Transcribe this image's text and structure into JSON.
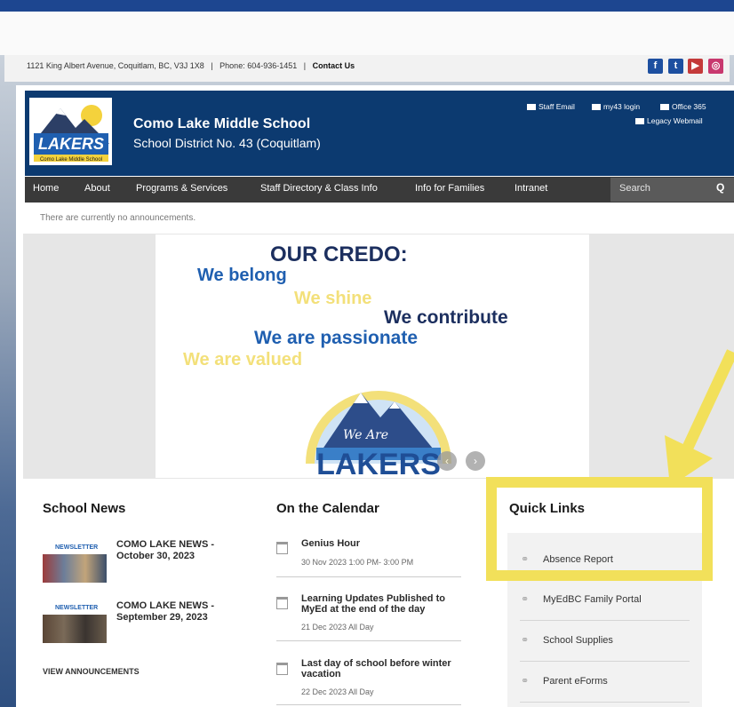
{
  "colors": {
    "header_bg": "#0c3a70",
    "nav_bg": "#3a3a3a",
    "highlight": "#f2e05a",
    "credo_blue": "#1f5fb0",
    "credo_yellow": "#f3e07a"
  },
  "address_bar": {
    "address": "1121 King Albert Avenue, Coquitlam, BC, V3J 1X8",
    "sep1": "|",
    "phone": "Phone: 604-936-1451",
    "sep2": "|",
    "contact": "Contact Us",
    "social": [
      "facebook-icon",
      "twitter-icon",
      "youtube-icon",
      "instagram-icon"
    ]
  },
  "header": {
    "logo_text": "LAKERS",
    "logo_caption": "Como Lake Middle School",
    "school_name": "Como Lake Middle School",
    "district": "School District No. 43 (Coquitlam)",
    "links": {
      "staff_email": "Staff Email",
      "my43": "my43 login",
      "office365": "Office 365",
      "legacy": "Legacy Webmail"
    }
  },
  "nav": {
    "items": [
      "Home",
      "About",
      "Programs & Services",
      "Staff Directory & Class Info",
      "Info for Families",
      "Intranet"
    ],
    "search_placeholder": "Search"
  },
  "announcement": "There are currently no announcements.",
  "slider": {
    "heading": "OUR CREDO:",
    "lines": [
      "We belong",
      "We shine",
      "We contribute",
      "We are passionate",
      "We are valued"
    ],
    "badge_top": "We Are",
    "badge_bottom": "LAKERS"
  },
  "news": {
    "title": "School News",
    "thumb_label": "NEWSLETTER",
    "items": [
      {
        "title": "COMO LAKE NEWS - October 30, 2023"
      },
      {
        "title": "COMO LAKE NEWS - September 29, 2023"
      }
    ],
    "view_all": "VIEW ANNOUNCEMENTS"
  },
  "calendar": {
    "title": "On the Calendar",
    "events": [
      {
        "title": "Genius Hour",
        "date": "30 Nov 2023 1:00 PM- 3:00 PM"
      },
      {
        "title": "Learning Updates Published to MyEd at the end of the day",
        "date": "21 Dec 2023 All Day"
      },
      {
        "title": "Last day of school before winter vacation",
        "date": "22 Dec 2023 All Day"
      }
    ]
  },
  "quick_links": {
    "title": "Quick Links",
    "items": [
      "Absence Report",
      "MyEdBC Family Portal",
      "School Supplies",
      "Parent eForms"
    ]
  }
}
